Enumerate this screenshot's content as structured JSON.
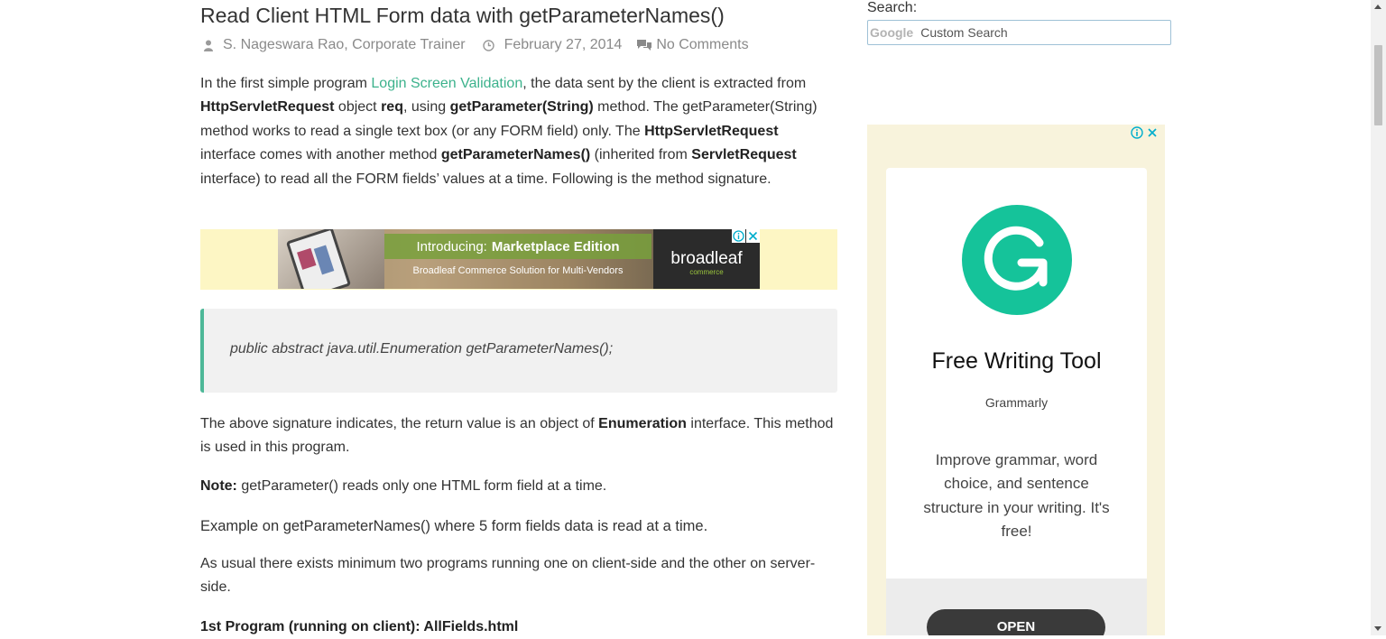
{
  "post": {
    "title": "Read Client HTML Form data with getParameterNames()",
    "author": "S. Nageswara Rao, Corporate Trainer",
    "date": "February 27, 2014",
    "comments": "No Comments"
  },
  "content": {
    "p1": {
      "t1": "In the first simple program ",
      "link": "Login Screen Validation",
      "t2": ", the data sent by the client is extracted from ",
      "b1": "HttpServletRequest",
      "t3": " object ",
      "b2": "req",
      "t4": ", using ",
      "b3": "getParameter(String)",
      "t5": " method. The getParameter(String) method works to read a single text box (or any FORM field) only. The ",
      "b4": "HttpServletRequest",
      "t6": " interface comes with another method ",
      "b5": "getParameterNames()",
      "t7": " (inherited from ",
      "b6": "ServletRequest",
      "t8": " interface) to read all the FORM fields’ values at a time. Following is the method signature."
    },
    "code": "public abstract java.util.Enumeration getParameterNames();",
    "p2": {
      "t1": "The above signature indicates, the return value is an object of ",
      "b1": "Enumeration",
      "t2": " interface. This method is used in this program."
    },
    "note": {
      "label": "Note:",
      "text": " getParameter() reads only one HTML form field at a time."
    },
    "p3": "Example on getParameterNames() where 5 form fields data is read at a time.",
    "p4": "As usual there exists minimum two programs running one on client-side and the other on server-side.",
    "p5": "1st Program (running on client): AllFields.html"
  },
  "banner_ad": {
    "intro": "Introducing:",
    "edition": "Marketplace Edition",
    "sub": "Broadleaf Commerce Solution for Multi-Vendors",
    "brand": "broadleaf",
    "brand_sub": "commerce",
    "info_icon": "info-icon",
    "close_icon": "close-icon"
  },
  "sidebar": {
    "search_label": "Search:",
    "google_watermark": "Google",
    "search_placeholder": "Custom Search"
  },
  "side_ad": {
    "title": "Free Writing Tool",
    "brand": "Grammarly",
    "description": "Improve grammar, word choice, and sentence structure in your writing. It's free!",
    "cta": "OPEN",
    "logo_icon": "grammarly-logo-icon"
  },
  "colors": {
    "link": "#3cb28c",
    "quote_border": "#4db898",
    "grammarly": "#15c39a",
    "ad_background": "#f8f3dc"
  }
}
